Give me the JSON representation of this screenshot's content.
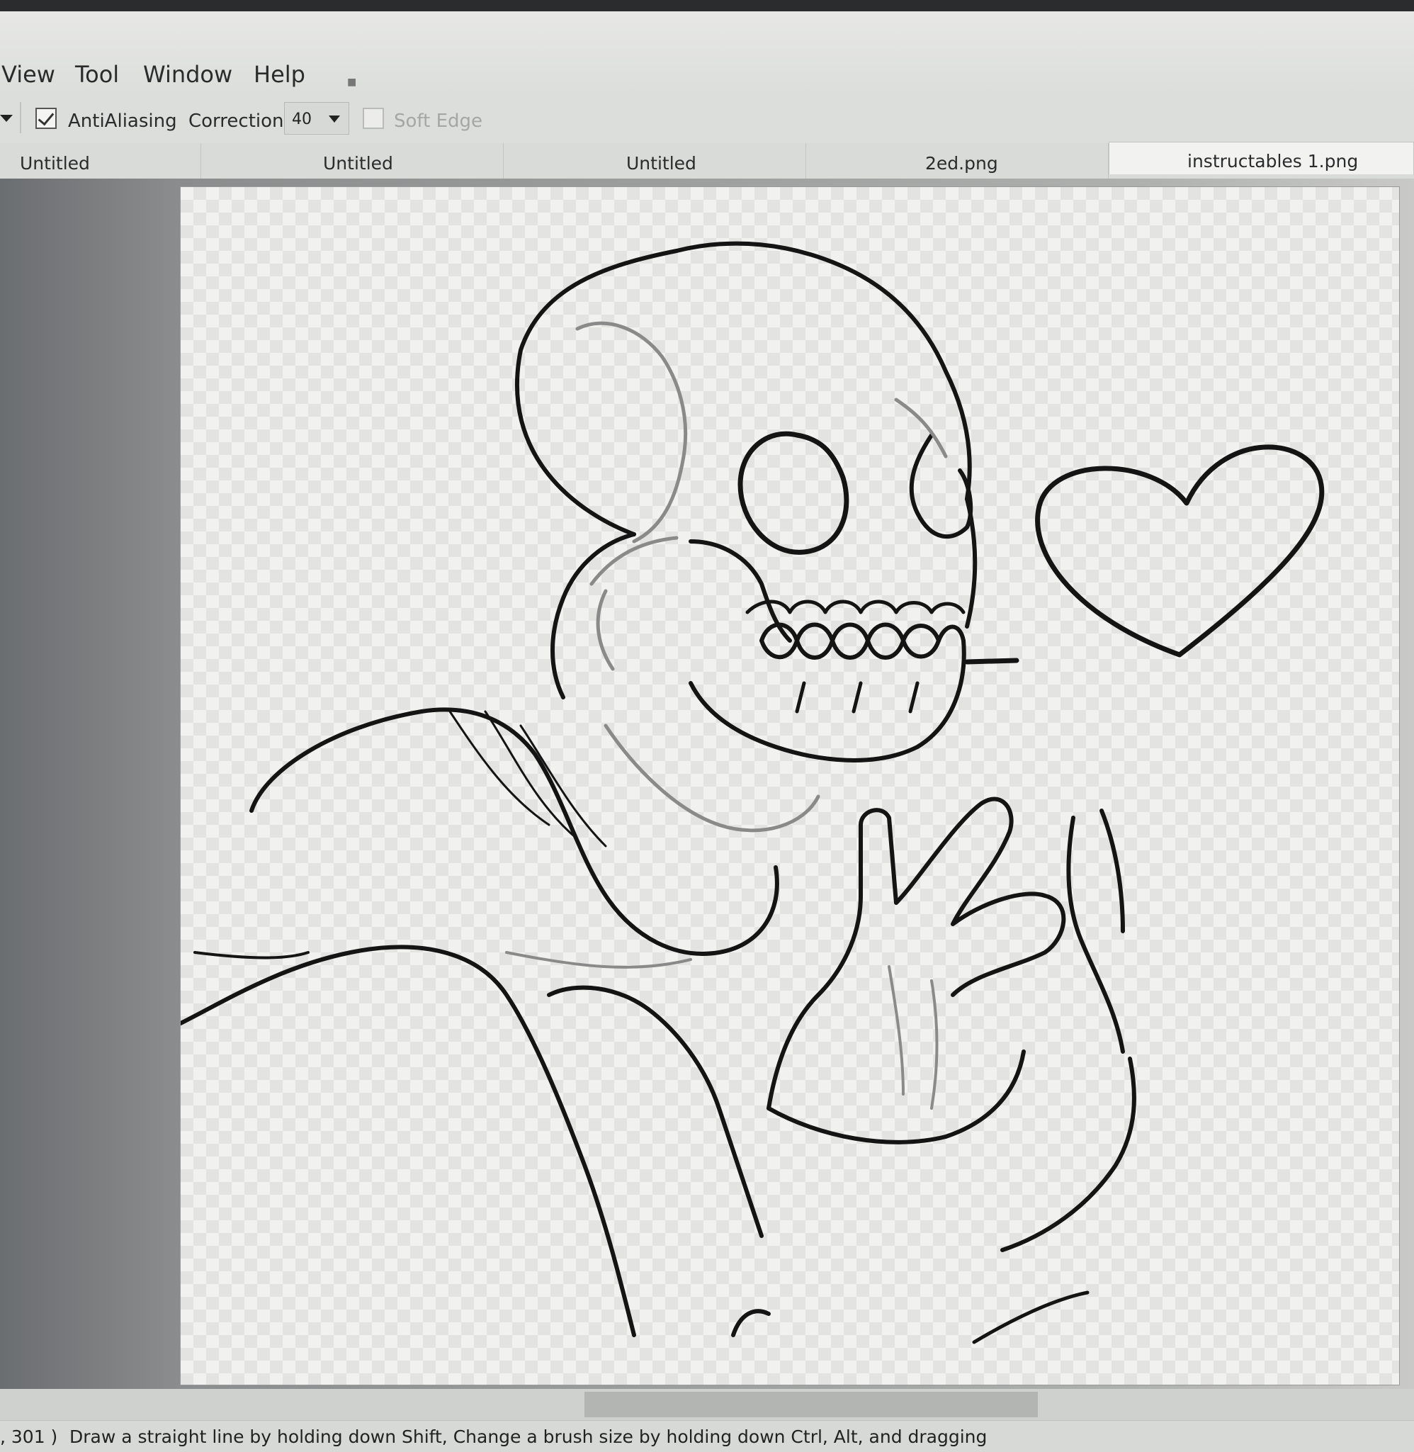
{
  "menu": {
    "items": [
      "View",
      "Tool",
      "Window",
      "Help"
    ]
  },
  "toolbar": {
    "antialiasing": {
      "label": "AntiAliasing",
      "checked": true
    },
    "correction": {
      "label": "Correction",
      "value": "40"
    },
    "soft_edge": {
      "label": "Soft Edge",
      "checked": false
    }
  },
  "tabs": [
    {
      "label": "Untitled",
      "active": false
    },
    {
      "label": "Untitled",
      "active": false
    },
    {
      "label": "Untitled",
      "active": false
    },
    {
      "label": "2ed.png",
      "active": false
    },
    {
      "label": "instructables 1.png",
      "active": true
    }
  ],
  "status": {
    "coords": ", 301 )",
    "hint": "Draw a straight line by holding down Shift, Change a brush size by holding down Ctrl, Alt, and dragging"
  },
  "canvas": {
    "document": "instructables 1.png",
    "subject": "skeleton-lineart"
  }
}
